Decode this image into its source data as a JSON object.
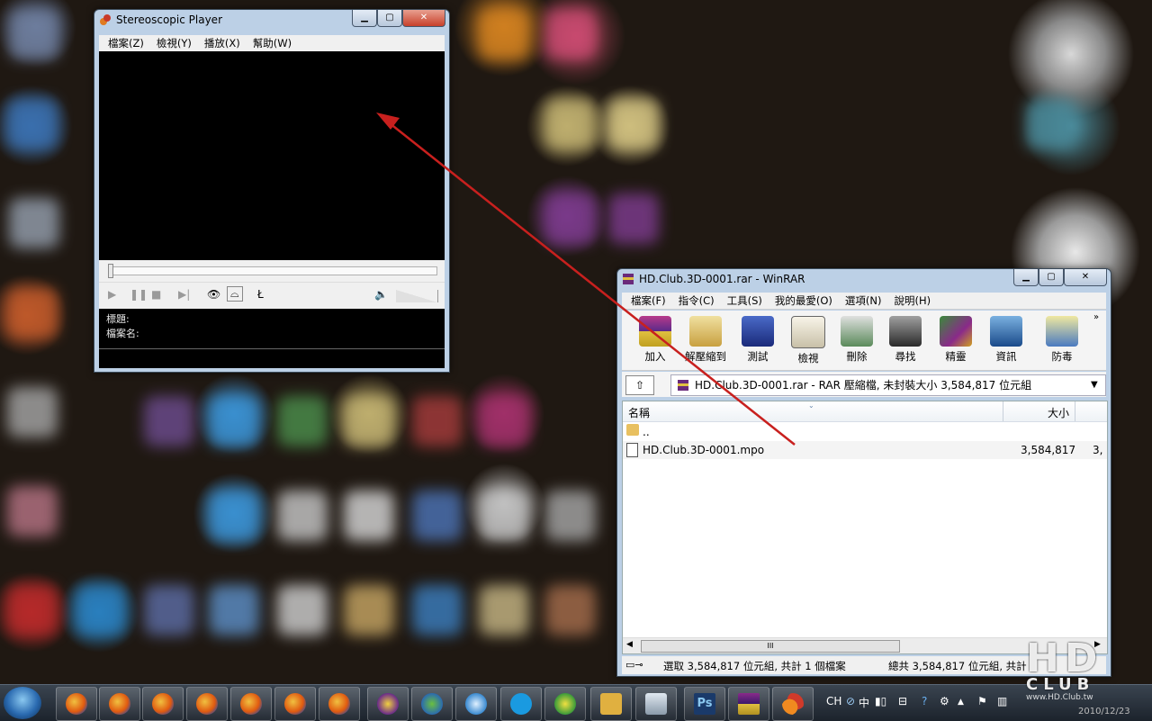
{
  "stereo_player": {
    "title": "Stereoscopic Player",
    "menu": [
      "檔案(Z)",
      "檢視(Y)",
      "播放(X)",
      "幫助(W)"
    ],
    "info_title_label": "標題:",
    "info_file_label": "檔案名:"
  },
  "winrar": {
    "title": "HD.Club.3D-0001.rar - WinRAR",
    "menu": [
      "檔案(F)",
      "指令(C)",
      "工具(S)",
      "我的最愛(O)",
      "選項(N)",
      "說明(H)"
    ],
    "toolbar": [
      "加入",
      "解壓縮到",
      "測試",
      "檢視",
      "刪除",
      "尋找",
      "精靈",
      "資訊",
      "防毒"
    ],
    "address": "HD.Club.3D-0001.rar - RAR 壓縮檔, 未封裝大小 3,584,817 位元組",
    "columns": {
      "name": "名稱",
      "size": "大小"
    },
    "rows": [
      {
        "name": "..",
        "size": "",
        "size2": ""
      },
      {
        "name": "HD.Club.3D-0001.mpo",
        "size": "3,584,817",
        "size2": "3,"
      }
    ],
    "scroll_grip": "III",
    "status_left": "選取 3,584,817 位元組, 共計 1 個檔案",
    "status_right": "總共 3,584,817 位元組, 共計 1"
  },
  "tray": {
    "lang": "CH",
    "ime": "中",
    "date": "2010/12/23"
  },
  "watermark": {
    "line1": "HD",
    "line2": "CLUB",
    "line3": "www.HD.Club.tw"
  },
  "colors": {
    "arrow": "#c8201e",
    "winrar_accent": "#2a4a8a"
  }
}
